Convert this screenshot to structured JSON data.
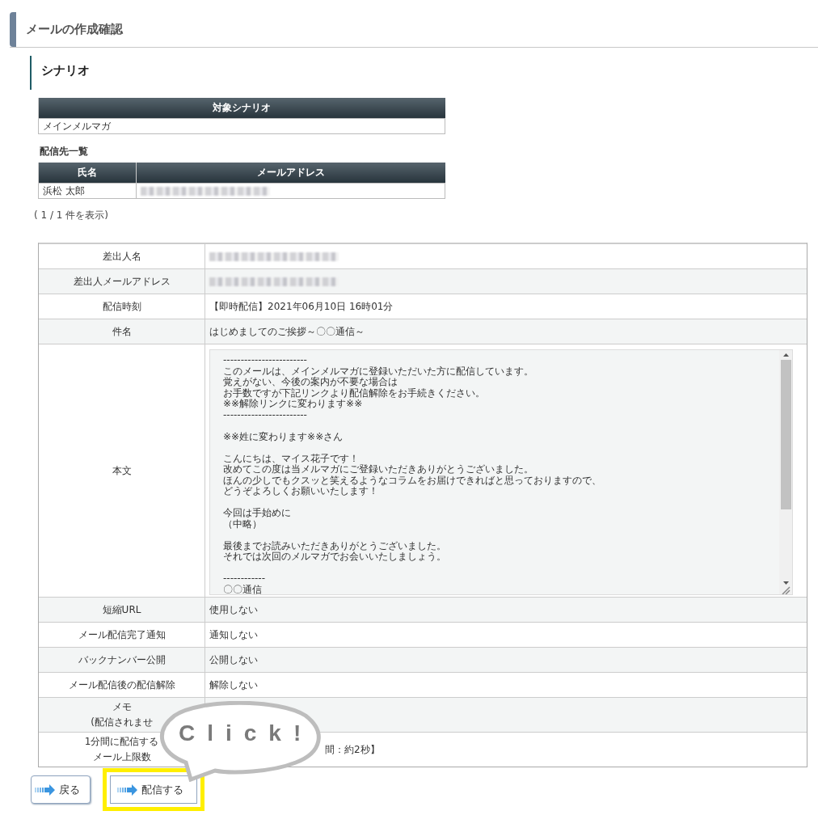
{
  "page_title": "メールの作成確認",
  "section_title": "シナリオ",
  "scenario_table": {
    "columns": [
      "対象シナリオ"
    ],
    "rows": [
      [
        {
          "kind": "text",
          "text": "メインメルマガ"
        }
      ]
    ]
  },
  "recipients": {
    "title": "配信先一覧",
    "columns": [
      "氏名",
      "メールアドレス"
    ],
    "rows": [
      [
        {
          "kind": "text",
          "text": "浜松 太郎"
        },
        {
          "kind": "redacted"
        }
      ]
    ],
    "count": "( 1 / 1 件を表示)"
  },
  "details": [
    {
      "label": [
        "差出人名"
      ],
      "value": {
        "kind": "redacted"
      }
    },
    {
      "label": [
        "差出人メールアドレス"
      ],
      "value": {
        "kind": "redacted"
      }
    },
    {
      "label": [
        "配信時刻"
      ],
      "value": {
        "kind": "text",
        "text": "【即時配信】2021年06月10日 16時01分"
      }
    },
    {
      "label": [
        "件名"
      ],
      "value": {
        "kind": "text",
        "text": "はじめましてのご挨拶～〇〇通信～"
      }
    },
    {
      "label": [
        "本文"
      ],
      "value": {
        "kind": "textarea",
        "paragraphs": [
          [
            "------------------------",
            "このメールは、メインメルマガに登録いただいた方に配信しています。",
            "覚えがない、今後の案内が不要な場合は",
            "お手数ですが下記リンクより配信解除をお手続きください。",
            "※※解除リンクに変わります※※",
            "------------------------"
          ],
          [
            "※※姓に変わります※※さん"
          ],
          [
            "こんにちは、マイス花子です！",
            "改めてこの度は当メルマガにご登録いただきありがとうございました。",
            "ほんの少しでもクスッと笑えるようなコラムをお届けできればと思っておりますので、",
            "どうぞよろしくお願いいたします！"
          ],
          [
            "今回は手始めに",
            "（中略）"
          ],
          [
            "最後までお読みいただきありがとうございました。",
            "それでは次回のメルマガでお会いいたしましょう。"
          ],
          [
            "------------",
            "〇〇通信"
          ]
        ]
      }
    },
    {
      "label": [
        "短縮URL"
      ],
      "value": {
        "kind": "text",
        "text": "使用しない"
      }
    },
    {
      "label": [
        "メール配信完了通知"
      ],
      "value": {
        "kind": "text",
        "text": "通知しない"
      }
    },
    {
      "label": [
        "バックナンバー公開"
      ],
      "value": {
        "kind": "text",
        "text": "公開しない"
      }
    },
    {
      "label": [
        "メール配信後の配信解除"
      ],
      "value": {
        "kind": "text",
        "text": "解除しない"
      }
    },
    {
      "label": [
        "メモ",
        "(配信されませ"
      ]
    },
    {
      "label": [
        "1分間に配信する",
        "メール上限数"
      ],
      "value": {
        "kind": "text",
        "text": "間：約2秒】"
      }
    }
  ],
  "buttons": [
    {
      "label": "戻る",
      "highlighted": false
    },
    {
      "label": "配信する",
      "highlighted": true
    }
  ],
  "callout": {
    "text": "Click!"
  }
}
